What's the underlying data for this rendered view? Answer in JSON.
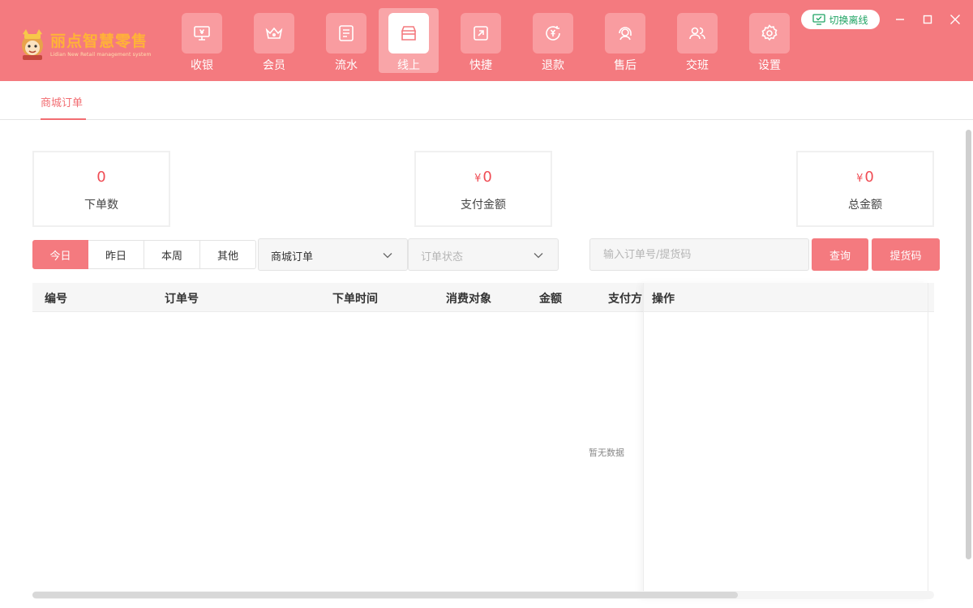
{
  "app": {
    "logo_title": "丽点智慧零售",
    "logo_subtitle": "Lidian New Retail management system"
  },
  "nav": [
    {
      "label": "收银",
      "icon": "cashier-icon"
    },
    {
      "label": "会员",
      "icon": "crown-icon"
    },
    {
      "label": "流水",
      "icon": "ledger-icon"
    },
    {
      "label": "线上",
      "icon": "store-icon"
    },
    {
      "label": "快捷",
      "icon": "shortcut-icon"
    },
    {
      "label": "退款",
      "icon": "refund-icon"
    },
    {
      "label": "售后",
      "icon": "headset-icon"
    },
    {
      "label": "交班",
      "icon": "users-icon"
    },
    {
      "label": "设置",
      "icon": "gear-icon"
    }
  ],
  "active_nav": "线上",
  "header": {
    "offline_label": "切换离线"
  },
  "tabs": {
    "mall_orders": "商城订单"
  },
  "stats": {
    "order_count": {
      "value": "0",
      "label": "下单数"
    },
    "paid_amount": {
      "currency": "¥",
      "value": "0",
      "label": "支付金额"
    },
    "total_amount": {
      "currency": "¥",
      "value": "0",
      "label": "总金额"
    }
  },
  "filters": {
    "ranges": [
      "今日",
      "昨日",
      "本周",
      "其他"
    ],
    "active_range": "今日",
    "order_type": "商城订单",
    "order_status_placeholder": "订单状态",
    "search_placeholder": "输入订单号/提货码",
    "query_label": "查询",
    "pickup_label": "提货码"
  },
  "table": {
    "columns": [
      "编号",
      "订单号",
      "下单时间",
      "消费对象",
      "金额",
      "支付方",
      "操作"
    ],
    "empty_text": "暂无数据"
  },
  "colors": {
    "brand": "#f47a7f",
    "accent_text": "#f04d55",
    "offline_green": "#1fa463"
  }
}
